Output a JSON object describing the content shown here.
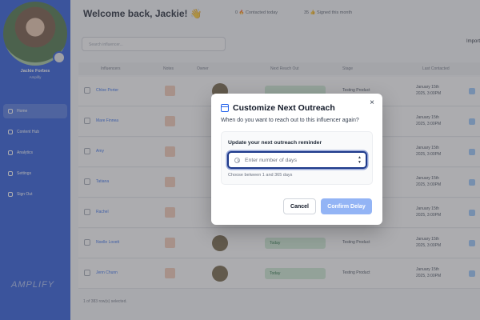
{
  "sidebar": {
    "profile_name": "Jackie Forbes",
    "profile_role": "Amplify",
    "items": [
      {
        "label": "Home",
        "icon": "home-icon"
      },
      {
        "label": "Content Hub",
        "icon": "content-icon"
      },
      {
        "label": "Analytics",
        "icon": "chart-icon"
      },
      {
        "label": "Settings",
        "icon": "gear-icon"
      },
      {
        "label": "Sign Out",
        "icon": "signout-icon"
      }
    ],
    "logo": "AMPLIFY"
  },
  "header": {
    "welcome": "Welcome back, Jackie! 👋",
    "stat_contacted": "0 🔥 Contacted today",
    "stat_signed": "35 👍 Signed this month"
  },
  "toolbar": {
    "search_placeholder": "Search influencer...",
    "import_label": "Import"
  },
  "table": {
    "columns": [
      "Influencers",
      "Notes",
      "Owner",
      "Next Reach Out",
      "Stage",
      "Last Contacted"
    ],
    "rows": [
      {
        "name": "Chloe Porter",
        "next": "",
        "stage": "Testing Product",
        "last": [
          "January 15th",
          "2025, 3:00PM"
        ]
      },
      {
        "name": "Mare Finnea",
        "next": "",
        "stage": "",
        "last": [
          "January 15th",
          "2025, 3:00PM"
        ]
      },
      {
        "name": "Amy",
        "next": "",
        "stage": "",
        "last": [
          "January 15th",
          "2025, 3:00PM"
        ]
      },
      {
        "name": "Tatiana",
        "next": "",
        "stage": "",
        "last": [
          "January 15th",
          "2025, 3:00PM"
        ]
      },
      {
        "name": "Rachel",
        "next": "",
        "stage": "",
        "last": [
          "January 15th",
          "2025, 3:00PM"
        ]
      },
      {
        "name": "Noelle Lovett",
        "next": "Today",
        "stage": "Testing Product",
        "last": [
          "January 15th",
          "2025, 3:00PM"
        ]
      },
      {
        "name": "Jenn Chunn",
        "next": "Today",
        "stage": "Testing Product",
        "last": [
          "January 15th",
          "2025, 3:00PM"
        ]
      }
    ],
    "pager": "1 of 383 row(s) selected."
  },
  "modal": {
    "title": "Customize Next Outreach",
    "subtitle": "When do you want to reach out to this influencer again?",
    "panel_label": "Update your next outreach reminder",
    "input_placeholder": "Enter number of days",
    "input_value": "",
    "hint": "Choose between 1 and 365 days",
    "cancel_label": "Cancel",
    "confirm_label": "Confirm Delay",
    "close_glyph": "×",
    "stepper_up": "▲",
    "stepper_down": "▼"
  },
  "colors": {
    "sidebar": "#1d4fd8",
    "accent": "#2563eb",
    "confirm_disabled": "#93b4f5"
  }
}
